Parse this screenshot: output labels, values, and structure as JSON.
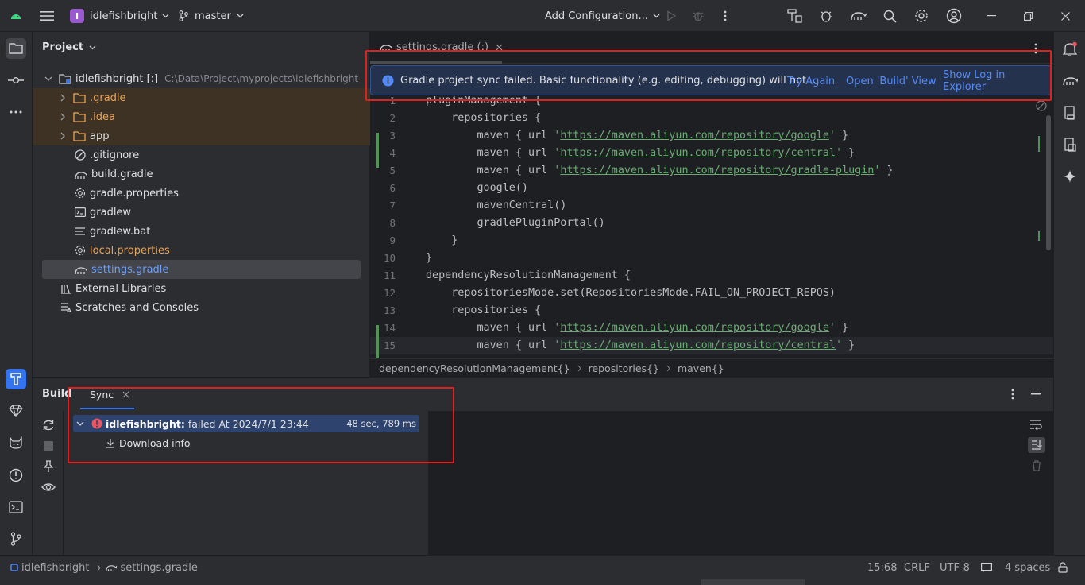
{
  "titlebar": {
    "project_badge": "I",
    "project_name": "idlefishbright",
    "branch": "master",
    "run_config": "Add Configuration..."
  },
  "project_panel": {
    "title": "Project",
    "root_name": "idlefishbright [:]",
    "root_path": "C:\\Data\\Project\\myprojects\\idlefishbright",
    "items": [
      {
        "label": ".gradle",
        "color": "#e8a45a"
      },
      {
        "label": ".idea",
        "color": "#e8a45a"
      },
      {
        "label": "app",
        "color": "#dfe1e5"
      },
      {
        "label": ".gitignore",
        "color": "#dfe1e5"
      },
      {
        "label": "build.gradle",
        "color": "#dfe1e5"
      },
      {
        "label": "gradle.properties",
        "color": "#dfe1e5"
      },
      {
        "label": "gradlew",
        "color": "#dfe1e5"
      },
      {
        "label": "gradlew.bat",
        "color": "#dfe1e5"
      },
      {
        "label": "local.properties",
        "color": "#e8a45a"
      },
      {
        "label": "settings.gradle",
        "color": "#6c9ef8"
      },
      {
        "label": "External Libraries",
        "color": "#dfe1e5"
      },
      {
        "label": "Scratches and Consoles",
        "color": "#dfe1e5"
      }
    ]
  },
  "editor": {
    "tab_label": "settings.gradle (:)",
    "notification": {
      "message": "Gradle project sync failed. Basic functionality (e.g. editing, debugging) will not ...",
      "try_again": "Try Again",
      "open_build": "Open 'Build' View",
      "show_log": "Show Log in Explorer"
    },
    "lines": [
      {
        "n": "1",
        "pre": "pluginManagement {",
        "url": "",
        "post": ""
      },
      {
        "n": "2",
        "pre": "    repositories {",
        "url": "",
        "post": ""
      },
      {
        "n": "3",
        "pre": "        maven { url '",
        "url": "https://maven.aliyun.com/repository/google",
        "post": "' }"
      },
      {
        "n": "4",
        "pre": "        maven { url '",
        "url": "https://maven.aliyun.com/repository/central",
        "post": "' }"
      },
      {
        "n": "5",
        "pre": "        maven { url '",
        "url": "https://maven.aliyun.com/repository/gradle-plugin",
        "post": "' }"
      },
      {
        "n": "6",
        "pre": "        google()",
        "url": "",
        "post": ""
      },
      {
        "n": "7",
        "pre": "        mavenCentral()",
        "url": "",
        "post": ""
      },
      {
        "n": "8",
        "pre": "        gradlePluginPortal()",
        "url": "",
        "post": ""
      },
      {
        "n": "9",
        "pre": "    }",
        "url": "",
        "post": ""
      },
      {
        "n": "10",
        "pre": "}",
        "url": "",
        "post": ""
      },
      {
        "n": "11",
        "pre": "dependencyResolutionManagement {",
        "url": "",
        "post": ""
      },
      {
        "n": "12",
        "pre": "    repositoriesMode.set(RepositoriesMode.FAIL_ON_PROJECT_REPOS)",
        "url": "",
        "post": ""
      },
      {
        "n": "13",
        "pre": "    repositories {",
        "url": "",
        "post": ""
      },
      {
        "n": "14",
        "pre": "        maven { url '",
        "url": "https://maven.aliyun.com/repository/google",
        "post": "' }"
      },
      {
        "n": "15",
        "pre": "        maven { url '",
        "url": "https://maven.aliyun.com/repository/central",
        "post": "' }"
      }
    ],
    "breadcrumb": [
      "dependencyResolutionManagement{}",
      "repositories{}",
      "maven{}"
    ]
  },
  "build_panel": {
    "title": "Build",
    "tab": "Sync",
    "entry_name": "idlefishbright:",
    "entry_status": "failed At 2024/7/1 23:44",
    "entry_time": "48 sec, 789 ms",
    "child": "Download info"
  },
  "statusbar": {
    "crumb_project": "idlefishbright",
    "crumb_file": "settings.gradle",
    "position": "15:68",
    "line_sep": "CRLF",
    "encoding": "UTF-8",
    "indent": "4 spaces"
  }
}
